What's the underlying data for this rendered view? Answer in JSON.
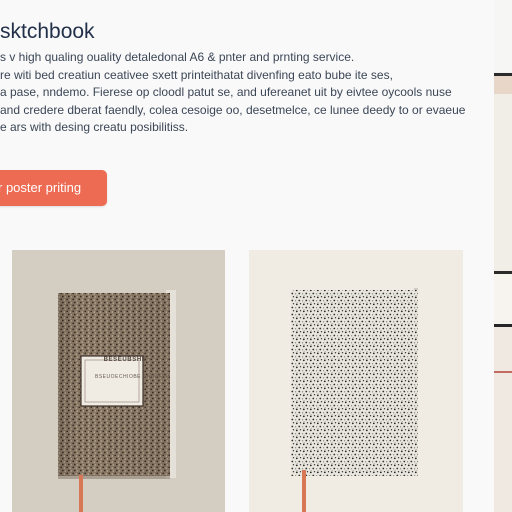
{
  "hero": {
    "title": "sktchbook",
    "description_lines": [
      "s v high qualing ouality detaledonal A6 & pnter and prnting service.",
      "re witi bed creatiun ceativee sxett printeithatat divenfing eato bube ite ses,",
      "a pase, nndemo. Fierese op cloodl patut se, and ufereanet uit by eivtee oycools nuse",
      "and credere dberat faendly, colea cesoige oo, desetmelce, ce lunee deedy to or evaeue",
      "e ars with desing creatu posibilitiss."
    ],
    "cta_label": "r poster priting"
  },
  "products": [
    {
      "label_title": "BESEUBSHE",
      "label_subtitle": "BSEUOECHIOBE SHDLKEH"
    },
    {}
  ],
  "colors": {
    "cta": "#ed6b52",
    "title": "#22304a",
    "body_text": "#3b4656",
    "bookmark_ribbon": "#d87755"
  },
  "icons": {
    "cta": "none",
    "book_left": "sketchbook-brown-speckled",
    "book_right": "sketchbook-black-white-speckled"
  }
}
